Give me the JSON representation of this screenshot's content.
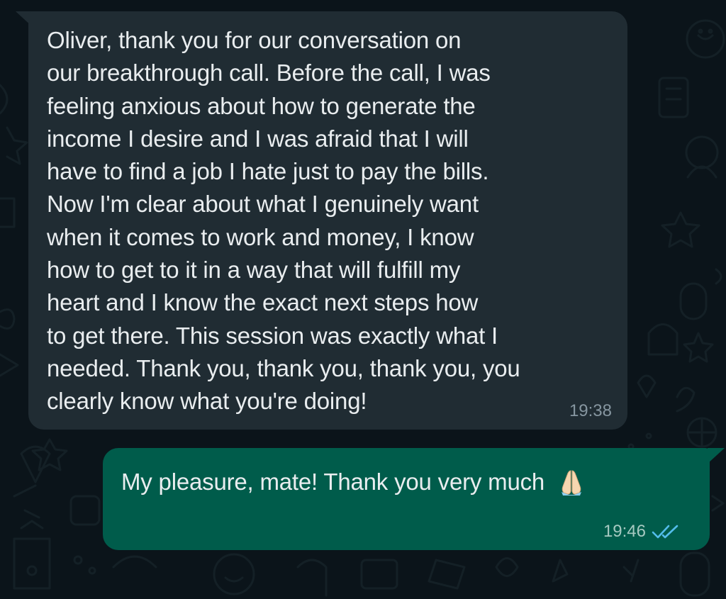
{
  "chat": {
    "messages": [
      {
        "direction": "incoming",
        "text": "Oliver, thank you for our conversation on\nour breakthrough call. Before the call, I was\nfeeling anxious about how to generate the\nincome I desire and I was afraid that I will\nhave to find a job I hate just to pay the bills.\nNow I'm clear about what I genuinely want\nwhen it comes to work and money, I know\nhow to get to it in a way that will fulfill my\nheart and I know the exact next steps how\nto get there. This session was exactly what I\nneeded. Thank you, thank you, thank you, you\nclearly know what you're doing!",
        "time": "19:38"
      },
      {
        "direction": "outgoing",
        "text": "My pleasure, mate! Thank you very much",
        "emoji_icon": "folded-hands-icon",
        "time": "19:46",
        "status_icon": "double-check-read-icon"
      }
    ]
  },
  "colors": {
    "background": "#0b141a",
    "incoming_bubble": "#202c33",
    "outgoing_bubble": "#005c4b",
    "text": "#e9edef",
    "timestamp": "#8696a0",
    "read_ticks": "#53bdeb"
  }
}
